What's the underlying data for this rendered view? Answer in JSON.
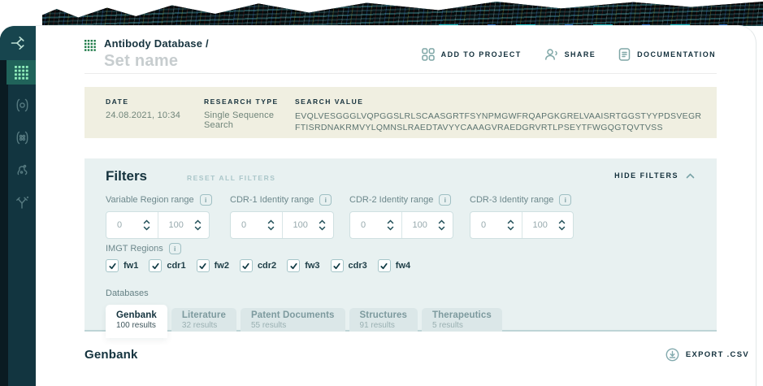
{
  "colors": {
    "sidebar_bg": "#123540",
    "sidebar_strip": "#0a1b22",
    "sidebar_active_bg": "#20635a",
    "sidebar_active_icon": "#8fedbb",
    "accent_dark": "#13323d",
    "summary_bg": "#f0efe1",
    "filters_bg": "#e8f1f1",
    "breadcrumb_grid_icon": "#1e7b48",
    "muted_teal": "#7ea6a6"
  },
  "sidebar": {
    "items": [
      {
        "id": "logo",
        "icon": "antibody-logo-icon",
        "active": false
      },
      {
        "id": "antibody-database",
        "icon": "grid-icon",
        "active": true
      },
      {
        "id": "scan",
        "icon": "scan-circle-icon",
        "active": false
      },
      {
        "id": "clusters",
        "icon": "cluster-dots-icon",
        "active": false
      },
      {
        "id": "structures",
        "icon": "structure-icon",
        "active": false
      },
      {
        "id": "antibody",
        "icon": "antibody-y-icon",
        "active": false
      }
    ]
  },
  "header": {
    "breadcrumb": "Antibody Database /",
    "subtitle": "Set name",
    "actions": [
      {
        "label": "ADD TO PROJECT",
        "icon": "add-to-project-icon"
      },
      {
        "label": "SHARE",
        "icon": "share-icon"
      },
      {
        "label": "DOCUMENTATION",
        "icon": "documentation-icon"
      }
    ]
  },
  "summary": {
    "date_label": "DATE",
    "date_value": "24.08.2021, 10:34",
    "research_type_label": "RESEARCH TYPE",
    "research_type_value": "Single Sequence Search",
    "search_value_label": "SEARCH VALUE",
    "search_value": "EVQLVESGGGLVQPGGSLRLSCAASGRTFSYNPMGWFRQAPGKGRELVAAISRTGGSTYYPDSVEGRFTISRDNAKRMVYLQMNSLRAEDTAVYYCAAAGVRAEDGRVRTLPSEYTFWGQGTQVTVSS"
  },
  "filters": {
    "title": "Filters",
    "reset_label": "RESET ALL FILTERS",
    "hide_label": "HIDE FILTERS",
    "ranges": [
      {
        "label": "Variable Region range",
        "min": "0",
        "max": "100"
      },
      {
        "label": "CDR-1 Identity range",
        "min": "0",
        "max": "100"
      },
      {
        "label": "CDR-2 Identity range",
        "min": "0",
        "max": "100"
      },
      {
        "label": "CDR-3 Identity range",
        "min": "0",
        "max": "100"
      }
    ],
    "imgt_label": "IMGT Regions",
    "imgt_regions": [
      {
        "label": "fw1",
        "checked": true
      },
      {
        "label": "cdr1",
        "checked": true
      },
      {
        "label": "fw2",
        "checked": true
      },
      {
        "label": "cdr2",
        "checked": true
      },
      {
        "label": "fw3",
        "checked": true
      },
      {
        "label": "cdr3",
        "checked": true
      },
      {
        "label": "fw4",
        "checked": true
      }
    ],
    "databases_label": "Databases",
    "tabs": [
      {
        "label": "Genbank",
        "results": "100 results",
        "active": true
      },
      {
        "label": "Literature",
        "results": "32 results",
        "active": false
      },
      {
        "label": "Patent Documents",
        "results": "55 results",
        "active": false
      },
      {
        "label": "Structures",
        "results": "91 results",
        "active": false
      },
      {
        "label": "Therapeutics",
        "results": "5 results",
        "active": false
      }
    ]
  },
  "results": {
    "title": "Genbank",
    "export_label": "EXPORT .CSV"
  }
}
